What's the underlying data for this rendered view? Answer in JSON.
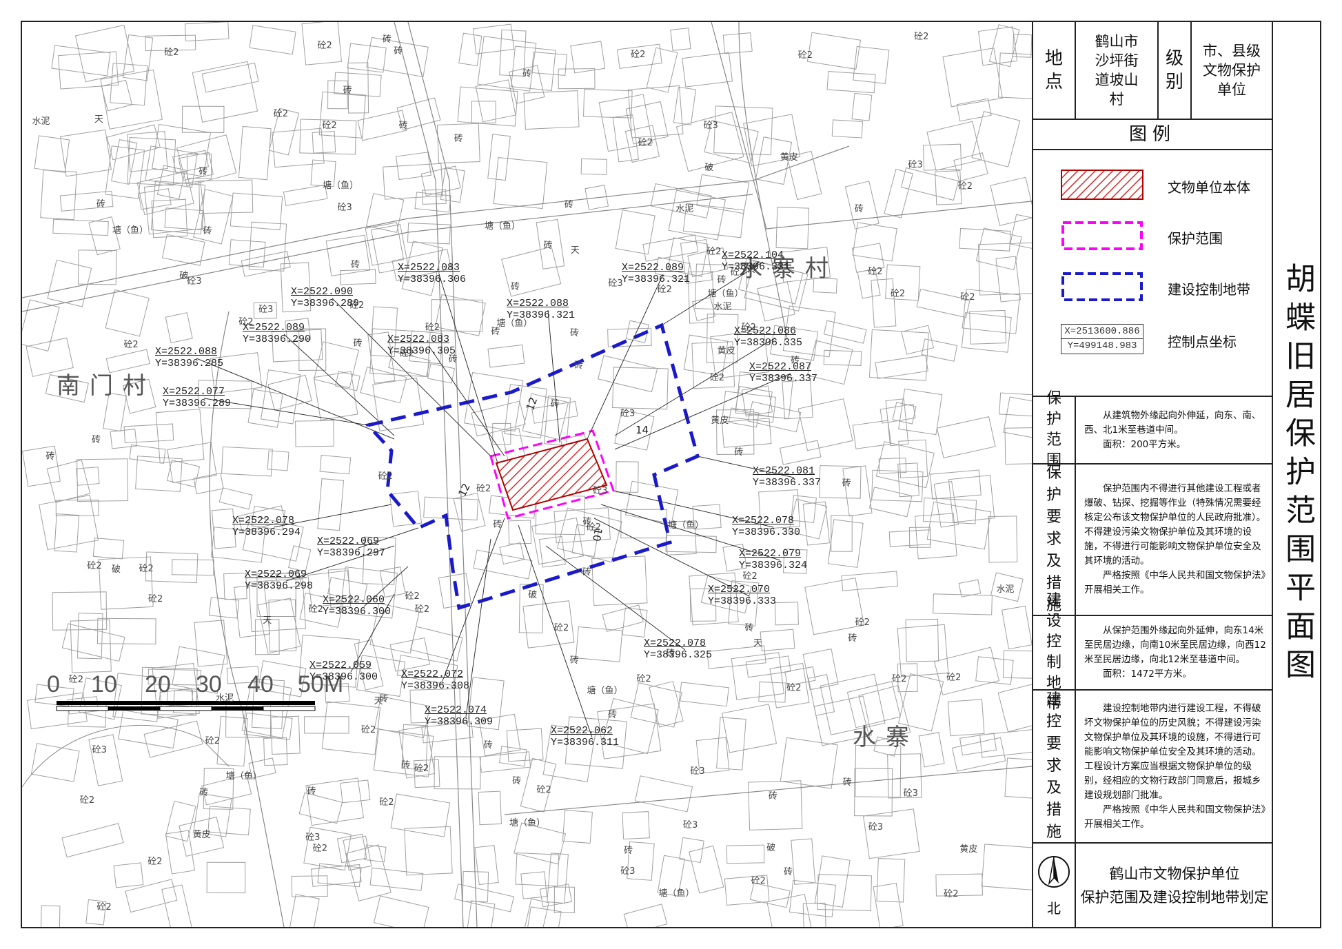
{
  "title": "胡蝶旧居保护范围平面图",
  "info": {
    "location_label": "地点",
    "location_value": "鹤山市沙坪街道坡山村",
    "level_label": "级别",
    "level_value": "市、县级文物保护单位"
  },
  "legend": {
    "title": "图例",
    "items": [
      {
        "label": "文物单位本体",
        "symbol": "hatched-red-box"
      },
      {
        "label": "保护范围",
        "symbol": "magenta-dashed-box"
      },
      {
        "label": "建设控制地带",
        "symbol": "blue-dashed-box"
      },
      {
        "label": "控制点坐标",
        "symbol": "coordinate-box"
      }
    ],
    "coord_sample": {
      "x": "X=2513600.886",
      "y": "Y=499148.983"
    }
  },
  "sections": [
    {
      "label": "保护范围",
      "text": [
        "从建筑物外缘起向外伸延，向东、南、西、北1米至巷道中间。",
        "面积：200平方米。"
      ]
    },
    {
      "label": "保护要求及措施",
      "text": [
        "保护范围内不得进行其他建设工程或者爆破、钻探、挖掘等作业（特殊情况需要经核定公布该文物保护单位的人民政府批准）。不得建设污染文物保护单位及其环境的设施，不得进行可能影响文物保护单位安全及其环境的活动。",
        "严格按照《中华人民共和国文物保护法》开展相关工作。"
      ]
    },
    {
      "label": "建设控制地带",
      "text": [
        "从保护范围外缘起向外延伸，向东14米至民居边缘，向南10米至民居边缘，向西12米至民居边缘，向北12米至巷道中间。",
        "面积：1472平方米。"
      ]
    },
    {
      "label": "建控要求及措施",
      "text": [
        "建设控制地带内进行建设工程，不得破坏文物保护单位的历史风貌；不得建设污染文物保护单位及其环境的设施，不得进行可能影响文物保护单位安全及其环境的活动。工程设计方案应当根据文物保护单位的级别，经相应的文物行政部门同意后，报城乡建设规划部门批准。",
        "严格按照《中华人民共和国文物保护法》开展相关工作。"
      ]
    }
  ],
  "footer": {
    "north_label": "北",
    "org_line1": "鹤山市文物保护单位",
    "org_line2": "保护范围及建设控制地带划定"
  },
  "map": {
    "place_names": [
      "南门村",
      "水寨村",
      "水寨"
    ],
    "dimensions": [
      "12",
      "14",
      "12",
      "10"
    ],
    "scale_labels": [
      "0",
      "10",
      "20",
      "30",
      "40",
      "50M"
    ],
    "building_labels": [
      "砼2",
      "砖",
      "砼3",
      "砼2",
      "砖",
      "砼2",
      "砖",
      "砼3",
      "砖",
      "砼2",
      "砼2",
      "砖",
      "砼2",
      "砖",
      "砼3",
      "砼2",
      "砖",
      "砼2",
      "砖",
      "砼2",
      "水泥",
      "黄皮",
      "塘（鱼）",
      "塘（鱼）",
      "天",
      "破",
      "砼2",
      "砖"
    ],
    "control_points": [
      {
        "x": "X=2522.083",
        "y": "Y=38396.306"
      },
      {
        "x": "X=2522.089",
        "y": "Y=38396.321"
      },
      {
        "x": "X=2522.104",
        "y": "Y=38396.331"
      },
      {
        "x": "X=2522.090",
        "y": "Y=38396.289"
      },
      {
        "x": "X=2522.088",
        "y": "Y=38396.321"
      },
      {
        "x": "X=2522.089",
        "y": "Y=38396.290"
      },
      {
        "x": "X=2522.083",
        "y": "Y=38396.305"
      },
      {
        "x": "X=2522.086",
        "y": "Y=38396.335"
      },
      {
        "x": "X=2522.088",
        "y": "Y=38396.285"
      },
      {
        "x": "X=2522.087",
        "y": "Y=38396.337"
      },
      {
        "x": "X=2522.077",
        "y": "Y=38396.289"
      },
      {
        "x": "X=2522.081",
        "y": "Y=38396.337"
      },
      {
        "x": "X=2522.078",
        "y": "Y=38396.294"
      },
      {
        "x": "X=2522.078",
        "y": "Y=38396.330"
      },
      {
        "x": "X=2522.069",
        "y": "Y=38396.297"
      },
      {
        "x": "X=2522.079",
        "y": "Y=38396.324"
      },
      {
        "x": "X=2522.069",
        "y": "Y=38396.298"
      },
      {
        "x": "X=2522.070",
        "y": "Y=38396.333"
      },
      {
        "x": "X=2522.060",
        "y": "Y=38396.300"
      },
      {
        "x": "X=2522.078",
        "y": "Y=38396.325"
      },
      {
        "x": "X=2522.059",
        "y": "Y=38396.300"
      },
      {
        "x": "X=2522.072",
        "y": "Y=38396.308"
      },
      {
        "x": "X=2522.074",
        "y": "Y=38396.309"
      },
      {
        "x": "X=2522.062",
        "y": "Y=38396.311"
      }
    ]
  },
  "colors": {
    "relic_fill": "#d42a2a",
    "protection_line": "#ff00ff",
    "control_line": "#1a1acc",
    "basemap_line": "#9a9a9a"
  }
}
